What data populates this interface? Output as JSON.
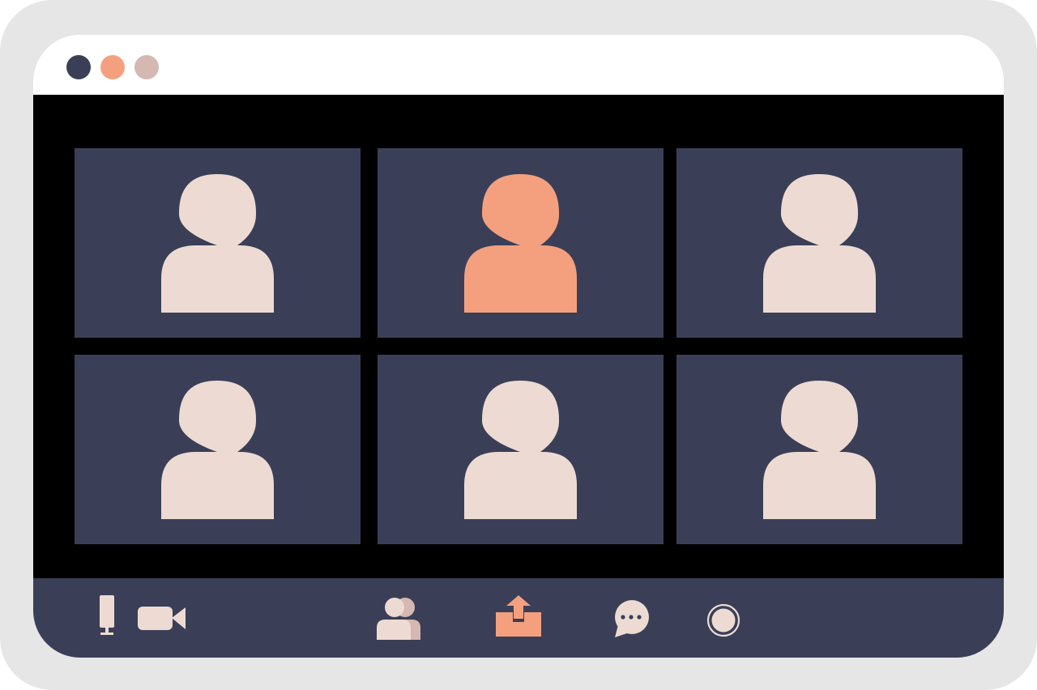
{
  "colors": {
    "frame": "#e6e6e6",
    "titlebar": "#ffffff",
    "stage_background": "#000000",
    "tile_background": "#3a3f57",
    "avatar_default": "#eddbd3",
    "avatar_active": "#f4a07f",
    "toolbar_background": "#3a3f57",
    "window_controls": [
      "#3a3f57",
      "#f4a07f",
      "#d5b8b1"
    ]
  },
  "window_controls": [
    {
      "name": "window-dot-dark"
    },
    {
      "name": "window-dot-orange"
    },
    {
      "name": "window-dot-pink"
    }
  ],
  "participants": [
    {
      "icon": "person-icon",
      "active": false
    },
    {
      "icon": "person-icon",
      "active": true
    },
    {
      "icon": "person-icon",
      "active": false
    },
    {
      "icon": "person-icon",
      "active": false
    },
    {
      "icon": "person-icon",
      "active": false
    },
    {
      "icon": "person-icon",
      "active": false
    }
  ],
  "toolbar": {
    "tools": [
      "microphone-icon",
      "video-camera-icon",
      "participants-icon",
      "share-screen-icon",
      "chat-icon",
      "record-icon"
    ]
  }
}
